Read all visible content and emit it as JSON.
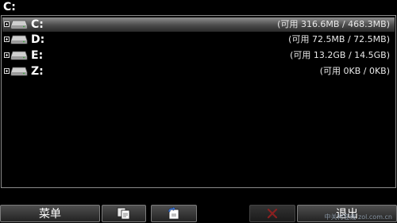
{
  "path": {
    "current": "C:"
  },
  "drives": [
    {
      "label": "C:",
      "info": "(可用 316.6MB / 468.3MB)",
      "selected": true
    },
    {
      "label": "D:",
      "info": "(可用 72.5MB / 72.5MB)",
      "selected": false
    },
    {
      "label": "E:",
      "info": "(可用 13.2GB / 14.5GB)",
      "selected": false
    },
    {
      "label": "Z:",
      "info": "(可用 0KB / 0KB)",
      "selected": false
    }
  ],
  "softkeys": {
    "menu_label": "菜单",
    "copy_icon": "copy-icon",
    "move_icon": "move-icon",
    "delete_icon": "delete-icon",
    "exit_label": "退出"
  },
  "watermark": {
    "text": "中关村在线 zol.com.cn"
  },
  "colors": {
    "selected_row": "#8e8e8e",
    "background": "#000000",
    "border": "#8a8a8a"
  }
}
